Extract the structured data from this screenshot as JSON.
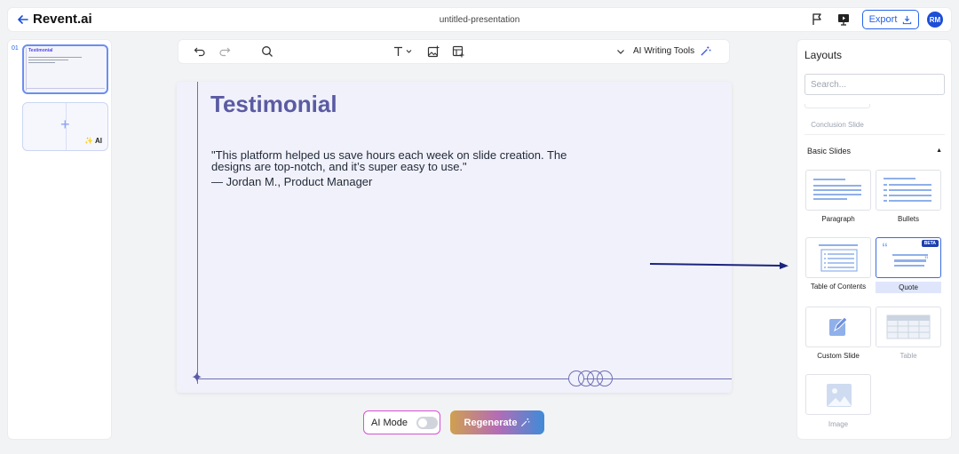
{
  "topbar": {
    "brand": "Revent.ai",
    "doc_title": "untitled-presentation",
    "export_label": "Export",
    "avatar_initials": "RM"
  },
  "thumbnails": {
    "slide_number": "01",
    "slide1_title": "Testimonial",
    "add_ai_label": "AI"
  },
  "toolbar": {
    "ai_tools_label": "AI Writing Tools"
  },
  "slide": {
    "title": "Testimonial",
    "quote": "\"This platform helped us save hours each week on slide creation. The designs are top-notch, and it’s super easy to use.\"",
    "author": "— Jordan M., Product Manager"
  },
  "bottom": {
    "ai_mode_label": "AI Mode",
    "regenerate_label": "Regenerate"
  },
  "layouts": {
    "title": "Layouts",
    "search_placeholder": "Search...",
    "conclusion_label": "Conclusion Slide",
    "section_basic": "Basic Slides",
    "cards": {
      "paragraph": "Paragraph",
      "bullets": "Bullets",
      "toc": "Table of Contents",
      "quote": "Quote",
      "quote_badge": "BETA",
      "custom": "Custom Slide",
      "table": "Table",
      "image": "Image"
    }
  },
  "colors": {
    "accent": "#2563eb",
    "slide_title": "#5b5ba3",
    "slide_bg": "#f1f1fb",
    "arrow": "#1a237e"
  }
}
